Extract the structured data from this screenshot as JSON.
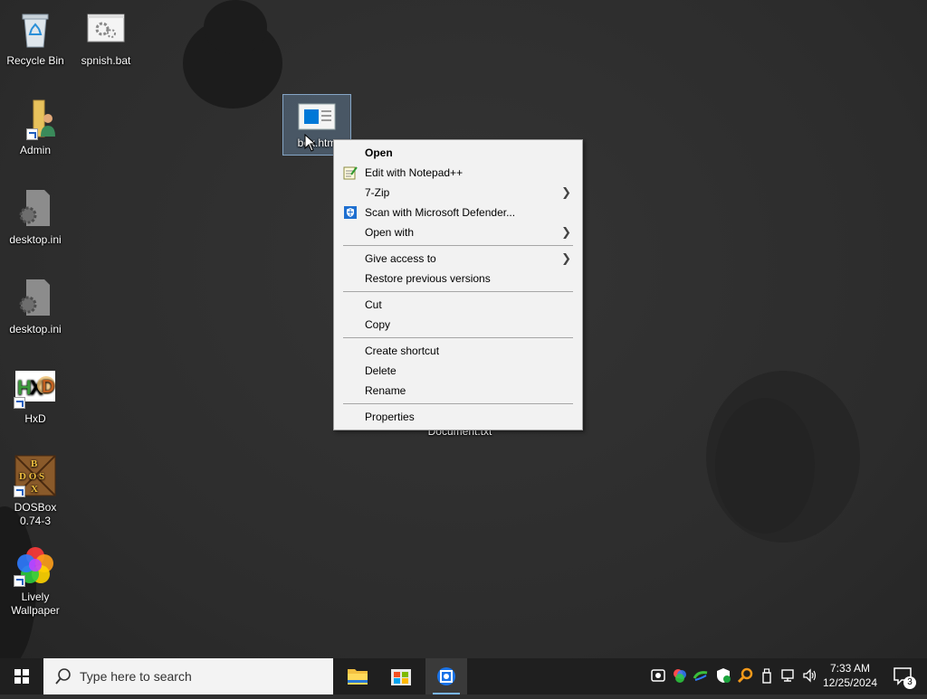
{
  "desktop": {
    "icons": [
      {
        "label": "Recycle Bin"
      },
      {
        "label": "spnish.bat"
      },
      {
        "label": "Admin"
      },
      {
        "label": "desktop.ini"
      },
      {
        "label": "desktop.ini"
      },
      {
        "label": "HxD"
      },
      {
        "label": "DOSBox 0.74-3"
      },
      {
        "label": "Lively Wallpaper"
      },
      {
        "label": "box.htm"
      },
      {
        "label": "Document.txt"
      }
    ]
  },
  "context_menu": {
    "items": [
      {
        "label": "Open"
      },
      {
        "label": "Edit with Notepad++"
      },
      {
        "label": "7-Zip"
      },
      {
        "label": "Scan with Microsoft Defender..."
      },
      {
        "label": "Open with"
      },
      {
        "label": "Give access to"
      },
      {
        "label": "Restore previous versions"
      },
      {
        "label": "Cut"
      },
      {
        "label": "Copy"
      },
      {
        "label": "Create shortcut"
      },
      {
        "label": "Delete"
      },
      {
        "label": "Rename"
      },
      {
        "label": "Properties"
      }
    ]
  },
  "taskbar": {
    "search_placeholder": "Type here to search",
    "clock_time": "7:33 AM",
    "clock_date": "12/25/2024",
    "notification_count": "3"
  },
  "colors": {
    "taskbar_bg": "#1f1f1f",
    "menu_bg": "#f2f2f2",
    "accent": "#0078d7"
  }
}
